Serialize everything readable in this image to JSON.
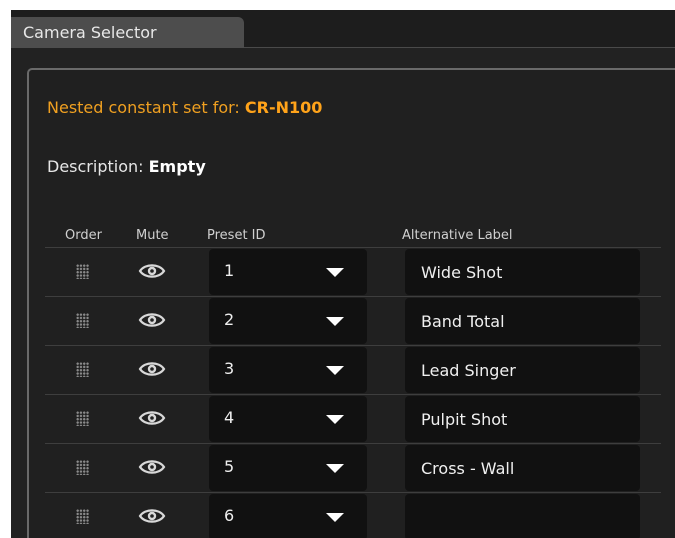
{
  "tab": {
    "label": "Camera Selector"
  },
  "header": {
    "nested_prefix": "Nested constant set for: ",
    "nested_value": "CR-N100",
    "description_prefix": "Description: ",
    "description_value": "Empty"
  },
  "columns": {
    "order": "Order",
    "mute": "Mute",
    "preset_id": "Preset ID",
    "alt_label": "Alternative Label"
  },
  "rows": [
    {
      "preset": "1",
      "alt": "Wide Shot"
    },
    {
      "preset": "2",
      "alt": "Band Total"
    },
    {
      "preset": "3",
      "alt": "Lead Singer"
    },
    {
      "preset": "4",
      "alt": "Pulpit Shot"
    },
    {
      "preset": "5",
      "alt": "Cross - Wall"
    },
    {
      "preset": "6",
      "alt": ""
    }
  ],
  "icons": {
    "order": "drag-handle-icon",
    "mute": "eye-icon",
    "dropdown": "caret-down-icon"
  },
  "colors": {
    "accent": "#f0a020",
    "background": "#222222",
    "field": "#111111",
    "tab": "#4d4d4d"
  }
}
